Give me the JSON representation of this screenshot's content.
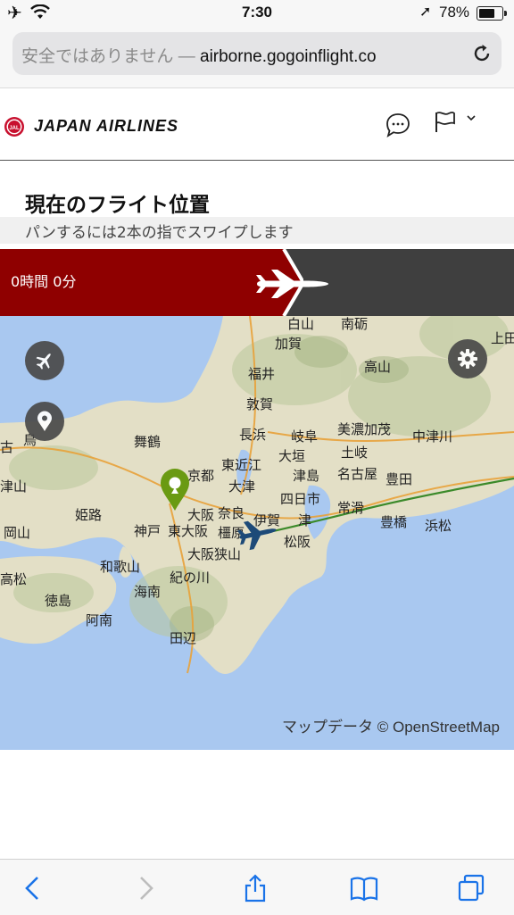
{
  "status_bar": {
    "time": "7:30",
    "battery_percent": "78%",
    "battery_level": 0.78,
    "icons": [
      "airplane-mode-icon",
      "wifi-icon",
      "location-icon",
      "battery-icon"
    ]
  },
  "browser": {
    "url_insecure_label": "安全ではありません —",
    "url_domain": "airborne.gogoinflight.co",
    "reload_icon": "reload-icon"
  },
  "header": {
    "brand": "JAPAN AIRLINES",
    "logo_text": "JAL",
    "icons": [
      "jal-crane-logo",
      "chat-icon",
      "flag-icon",
      "chevron-down-icon"
    ]
  },
  "flight": {
    "title": "現在のフライト位置",
    "hint": "パンするには2本の指でスワイプします",
    "remaining_time": "0時間 0分",
    "progress_fraction": 0.55
  },
  "map": {
    "attribution": "マップデータ © OpenStreetMap",
    "buttons": [
      "flight-mode-icon",
      "location-pin-icon",
      "gear-icon"
    ],
    "labels": [
      "白山",
      "南砺",
      "上田",
      "加賀",
      "福井",
      "高山",
      "敦賀",
      "岐阜",
      "美濃加茂",
      "中津川",
      "長浜",
      "大垣",
      "土岐",
      "舞鶴",
      "京都",
      "東近江",
      "津島",
      "名古屋",
      "豊田",
      "大津",
      "四日市",
      "常滑",
      "豊橋",
      "浜松",
      "鳥",
      "古",
      "津山",
      "姫路",
      "大阪",
      "奈良",
      "伊賀",
      "津",
      "岡山",
      "神戸",
      "東大阪",
      "橿原",
      "松阪",
      "和歌山",
      "大阪狭山",
      "紀の川",
      "高松",
      "徳島",
      "海南",
      "阿南",
      "田辺"
    ],
    "colors": {
      "sea": "#a9c8f0",
      "land": "#e6e2cc",
      "route": "#3b8a2a",
      "pin": "#6a9a12",
      "plane": "#1d4a78"
    }
  },
  "toolbar": {
    "icons": [
      "back-icon",
      "forward-icon",
      "share-icon",
      "bookmarks-icon",
      "tabs-icon"
    ],
    "accent": "#1a73e8"
  }
}
